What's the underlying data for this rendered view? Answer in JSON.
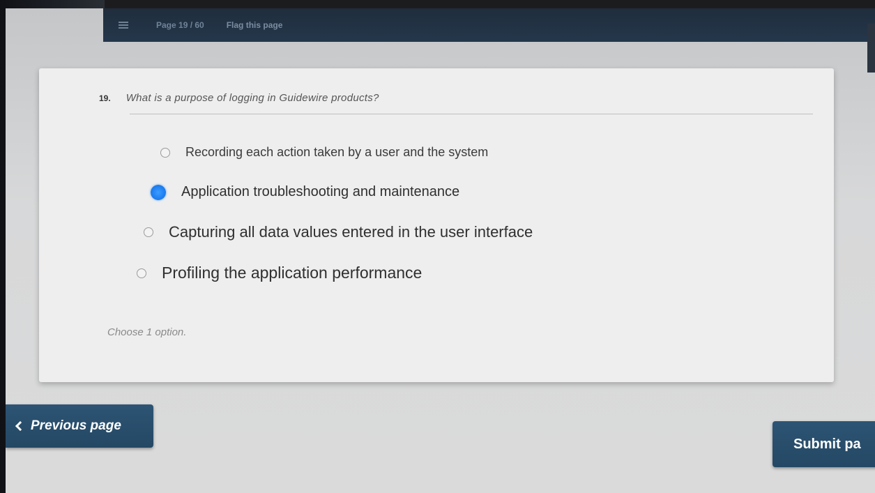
{
  "topbar": {
    "page_indicator": "Page 19 / 60",
    "flag_label": "Flag this page"
  },
  "question": {
    "number": "19.",
    "text": "What is a purpose of logging in Guidewire products?",
    "options": [
      {
        "label": "Recording each action taken by a user and the system",
        "selected": false
      },
      {
        "label": "Application troubleshooting and maintenance",
        "selected": true
      },
      {
        "label": "Capturing all data values entered in the user interface",
        "selected": false
      },
      {
        "label": "Profiling the application performance",
        "selected": false
      }
    ],
    "hint": "Choose 1 option."
  },
  "nav": {
    "previous_label": "Previous page",
    "submit_label": "Submit pa"
  },
  "colors": {
    "topbar": "#1f2d3d",
    "button": "#2d5474",
    "radio_selected": "#1e7ef0"
  }
}
